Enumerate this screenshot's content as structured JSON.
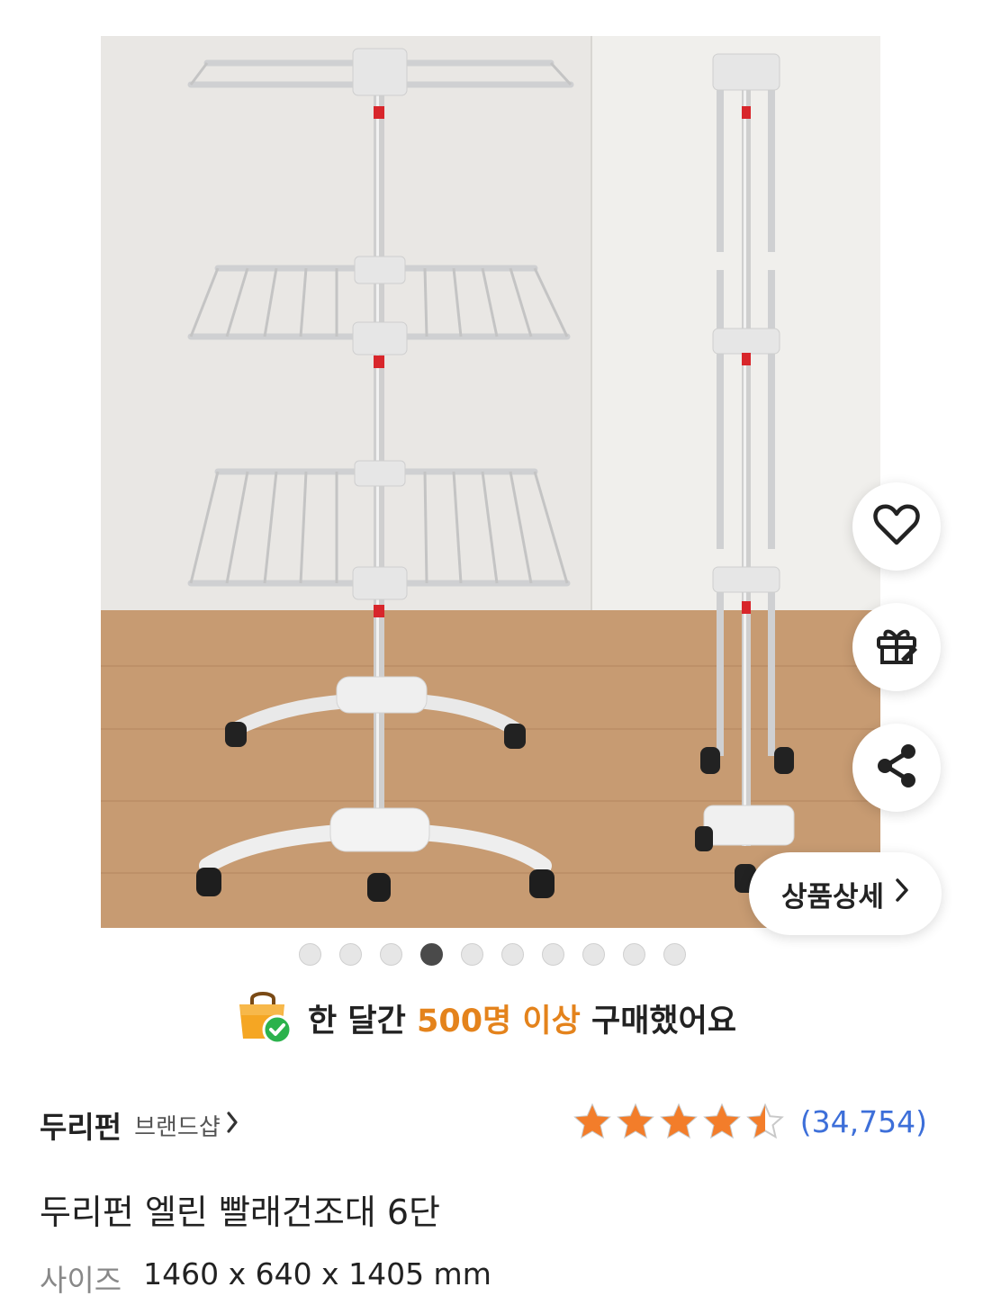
{
  "image": {
    "icons": [
      "heart-icon",
      "gift-icon",
      "share-icon"
    ],
    "detail_button_label": "상품상세"
  },
  "carousel": {
    "total": 10,
    "active_index": 3
  },
  "social_proof": {
    "prefix": "한 달간 ",
    "highlight": "500명 이상",
    "suffix": " 구매했어요",
    "highlight_color": "#e4831c"
  },
  "brand": {
    "name": "두리펀",
    "shop_label": "브랜드샵"
  },
  "rating": {
    "stars": 4.5,
    "count_label": "(34,754)",
    "star_color": "#f37d2a"
  },
  "product": {
    "title": "두리펀 엘린 빨래건조대 6단",
    "spec_label": "사이즈",
    "spec_value": "1460 x 640 x 1405 mm"
  }
}
